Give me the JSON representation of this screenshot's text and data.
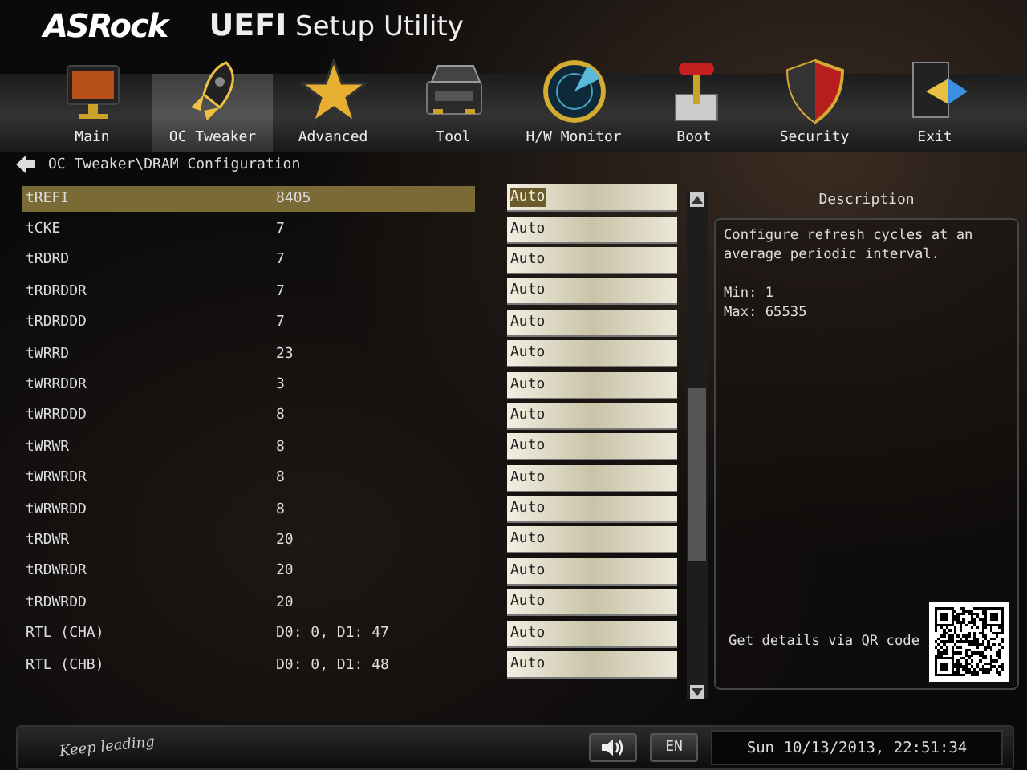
{
  "header": {
    "logo": "ASRock",
    "title": "**UEFI** Setup Utility"
  },
  "tabs": [
    {
      "label": "Main",
      "selected": false
    },
    {
      "label": "OC Tweaker",
      "selected": true
    },
    {
      "label": "Advanced",
      "selected": false
    },
    {
      "label": "Tool",
      "selected": false
    },
    {
      "label": "H/W Monitor",
      "selected": false
    },
    {
      "label": "Boot",
      "selected": false
    },
    {
      "label": "Security",
      "selected": false
    },
    {
      "label": "Exit",
      "selected": false
    }
  ],
  "breadcrumb": "OC Tweaker\\DRAM Configuration",
  "settings": [
    {
      "label": "tREFI",
      "value": "8405",
      "option": "Auto",
      "selected": true
    },
    {
      "label": "tCKE",
      "value": "7",
      "option": "Auto",
      "selected": false
    },
    {
      "label": "tRDRD",
      "value": "7",
      "option": "Auto",
      "selected": false
    },
    {
      "label": "tRDRDDR",
      "value": "7",
      "option": "Auto",
      "selected": false
    },
    {
      "label": "tRDRDDD",
      "value": "7",
      "option": "Auto",
      "selected": false
    },
    {
      "label": "tWRRD",
      "value": "23",
      "option": "Auto",
      "selected": false
    },
    {
      "label": "tWRRDDR",
      "value": "3",
      "option": "Auto",
      "selected": false
    },
    {
      "label": "tWRRDDD",
      "value": "8",
      "option": "Auto",
      "selected": false
    },
    {
      "label": "tWRWR",
      "value": "8",
      "option": "Auto",
      "selected": false
    },
    {
      "label": "tWRWRDR",
      "value": "8",
      "option": "Auto",
      "selected": false
    },
    {
      "label": "tWRWRDD",
      "value": "8",
      "option": "Auto",
      "selected": false
    },
    {
      "label": "tRDWR",
      "value": "20",
      "option": "Auto",
      "selected": false
    },
    {
      "label": "tRDWRDR",
      "value": "20",
      "option": "Auto",
      "selected": false
    },
    {
      "label": "tRDWRDD",
      "value": "20",
      "option": "Auto",
      "selected": false
    },
    {
      "label": "RTL (CHA)",
      "value": "D0: 0, D1: 47",
      "option": "Auto",
      "selected": false
    },
    {
      "label": "RTL (CHB)",
      "value": "D0: 0, D1: 48",
      "option": "Auto",
      "selected": false
    }
  ],
  "description": {
    "heading": "Description",
    "text": "Configure refresh cycles at an average periodic interval.",
    "min": "Min: 1",
    "max": "Max: 65535",
    "qr_label": "Get details via QR code"
  },
  "footer": {
    "slogan": "Keep leading",
    "language": "EN",
    "datetime": "Sun 10/13/2013, 22:51:34"
  }
}
